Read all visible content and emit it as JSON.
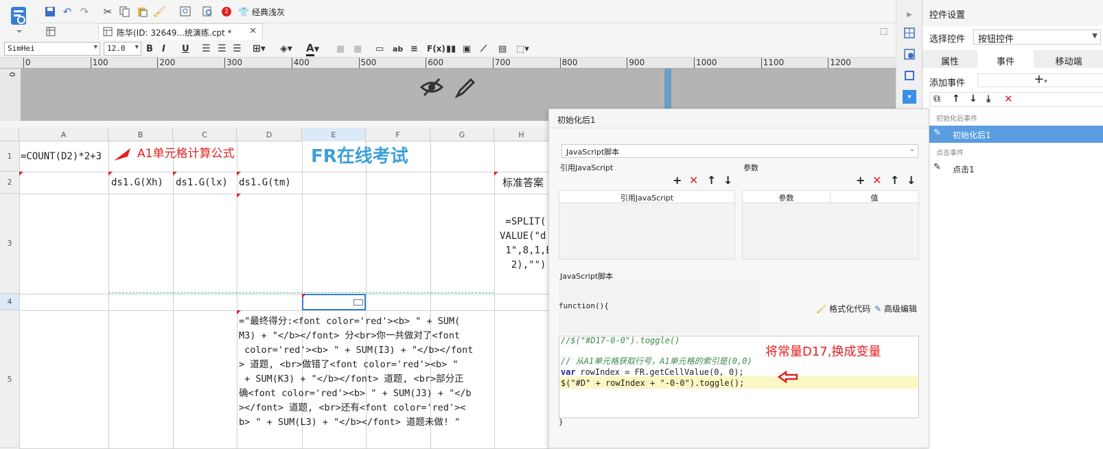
{
  "toolbar": {
    "notification_count": "2",
    "theme_label": "经典浅灰",
    "tab_title": "陈华(ID: 32649...统演练.cpt *",
    "font_name": "SimHei",
    "font_size": "12.0"
  },
  "ruler": {
    "labels": [
      "0",
      "100",
      "200",
      "300",
      "400",
      "500",
      "600",
      "700",
      "800",
      "900",
      "1000",
      "1100",
      "1200"
    ],
    "vertical_label": "0"
  },
  "sheet": {
    "columns": [
      "A",
      "B",
      "C",
      "D",
      "E",
      "F",
      "G",
      "H"
    ],
    "rows": [
      "1",
      "2",
      "3",
      "4",
      "5"
    ],
    "a1": "=COUNT(D2)*2+3",
    "annotation_a1": "A1单元格计算公式",
    "title": "FR在线考试",
    "b2": "ds1.G(Xh)",
    "c2": "ds1.G(lx)",
    "d2": "ds1.G(tm)",
    "h2": "标准答案",
    "h3": " =SPLIT(\nVALUE(\"d\n 1\",8,1,E\n  2),\"\")",
    "d5": "=\"最终得分:<font color='red'><b> \" + SUM(\nM3) + \"</b></font> 分<br>你一共做对了<font\n color='red'><b> \" + SUM(I3) + \"</b></font\n> 道题, <br>做错了<font color='red'><b> \"\n + SUM(K3) + \"</b></font> 道题, <br>部分正\n确<font color='red'><b> \" + SUM(J3) + \"</b\n></font> 道题, <br>还有<font color='red'><\nb> \" + SUM(L3) + \"</b></font> 道题未做! \""
  },
  "right_panel": {
    "title": "控件设置",
    "select_label": "选择控件",
    "select_value": "按钮控件",
    "tabs": [
      "属性",
      "事件",
      "移动端"
    ],
    "add_event_label": "添加事件",
    "group_after_init": "初始化后事件",
    "event_after_init": "初始化后1",
    "group_click": "点击事件",
    "event_click": "点击1"
  },
  "dialog": {
    "title": "初始化后1",
    "script_type": "JavaScript脚本",
    "ref_js_label": "引用JavaScript",
    "params_label": "参数",
    "ref_js_header": "引用JavaScript",
    "param_header": "参数",
    "value_header": "值",
    "js_script_label": "JavaScript脚本",
    "function_header": "function(){",
    "format_code": "格式化代码",
    "advanced_edit": "高级编辑",
    "code_line1": "//$(\"#D17-0-0\").toggle()",
    "code_line2": "// 从A1单元格获取行号，A1单元格的索引是(0,0)",
    "code_line3_kw": "var",
    "code_line3": " rowIndex = FR.getCellValue(0, 0);",
    "code_line4": "$(\"#D\" + rowIndex + \"-0-0\").toggle();",
    "annotation": "将常量D17,换成变量",
    "closing_brace": "}"
  },
  "colors": {
    "accent": "#3a6ec7",
    "annotation_red": "#e02020",
    "title_blue": "#3ba0d8",
    "selected_event": "#5a9de0"
  }
}
